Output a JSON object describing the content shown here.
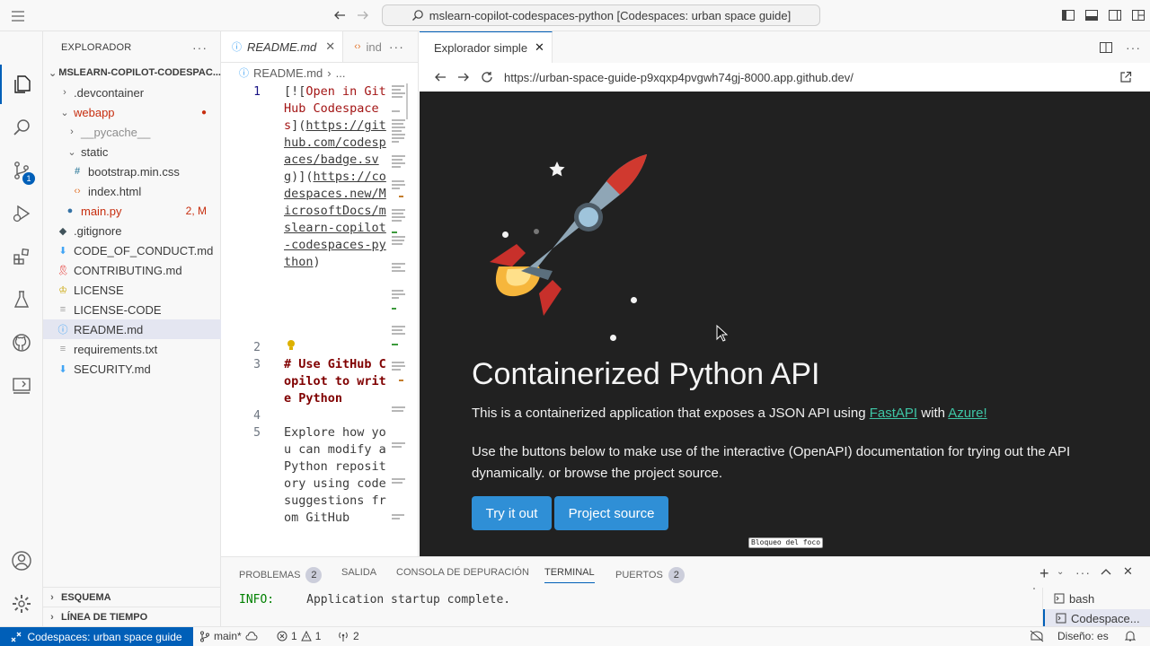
{
  "titlebar": {
    "command_center": "mslearn-copilot-codespaces-python [Codespaces: urban space guide]"
  },
  "activity": {
    "scm_badge": "1"
  },
  "sidebar": {
    "title": "EXPLORADOR",
    "root": "MSLEARN-COPILOT-CODESPAC...",
    "items": [
      {
        "label": ".devcontainer",
        "decoration": ""
      },
      {
        "label": "webapp",
        "decoration": "●"
      },
      {
        "label": "__pycache__",
        "decoration": ""
      },
      {
        "label": "static",
        "decoration": ""
      },
      {
        "label": "bootstrap.min.css",
        "decoration": ""
      },
      {
        "label": "index.html",
        "decoration": ""
      },
      {
        "label": "main.py",
        "decoration": "2, M"
      },
      {
        "label": ".gitignore",
        "decoration": ""
      },
      {
        "label": "CODE_OF_CONDUCT.md",
        "decoration": ""
      },
      {
        "label": "CONTRIBUTING.md",
        "decoration": ""
      },
      {
        "label": "LICENSE",
        "decoration": ""
      },
      {
        "label": "LICENSE-CODE",
        "decoration": ""
      },
      {
        "label": "README.md",
        "decoration": ""
      },
      {
        "label": "requirements.txt",
        "decoration": ""
      },
      {
        "label": "SECURITY.md",
        "decoration": ""
      }
    ],
    "outline": "ESQUEMA",
    "timeline": "LÍNEA DE TIEMPO"
  },
  "editor": {
    "tabs": [
      {
        "label": "README.md"
      },
      {
        "label": "ind"
      }
    ],
    "breadcrumb": "README.md",
    "breadcrumb_more": "...",
    "line_numbers": [
      "1",
      "2",
      "3",
      "4",
      "5"
    ],
    "line1": {
      "open": "[![",
      "alt": "Open in GitHub Codespaces",
      "mid": "](",
      "badge_url": "https://github.com/codespaces/badge.svg",
      "close1": ")]",
      "open2": "(",
      "link_url": "https://codespaces.new/MicrosoftDocs/mslearn-copilot-codespaces-python",
      "close2": ")"
    },
    "line3": "# Use GitHub Copilot to write Python",
    "line5": "Explore how you can modify a Python repository using code suggestions from GitHub"
  },
  "preview": {
    "tab": "Explorador simple",
    "url": "https://urban-space-guide-p9xqxp4pvgwh74gj-8000.app.github.dev/",
    "page": {
      "title": "Containerized Python API",
      "p1_prefix": "This is a containerized application that exposes a JSON API using ",
      "link_fastapi": "FastAPI",
      "p1_mid": " with ",
      "link_azure": "Azure!",
      "p2": "Use the buttons below to make use of the interactive (OpenAPI) documentation for trying out the API dynamically. or browse the project source.",
      "btn_try": "Try it out",
      "btn_source": "Project source"
    },
    "focus_lock": "Bloqueo del foco"
  },
  "panel": {
    "tabs": [
      {
        "label": "PROBLEMAS",
        "count": "2"
      },
      {
        "label": "SALIDA",
        "count": ""
      },
      {
        "label": "CONSOLA DE DEPURACIÓN",
        "count": ""
      },
      {
        "label": "TERMINAL",
        "count": ""
      },
      {
        "label": "PUERTOS",
        "count": "2"
      }
    ],
    "terminal_level": "INFO:",
    "terminal_message": "Application startup complete.",
    "terminals": [
      "bash",
      "Codespace..."
    ]
  },
  "status": {
    "remote": "Codespaces: urban space guide",
    "branch": "main*",
    "errors": "1",
    "warnings": "1",
    "ports": "2",
    "layout": "Diseño: es"
  },
  "colors": {
    "accent": "#005fb8",
    "web_background": "#212121",
    "web_button": "#2f8fd6",
    "link": "#3ec5a5"
  }
}
